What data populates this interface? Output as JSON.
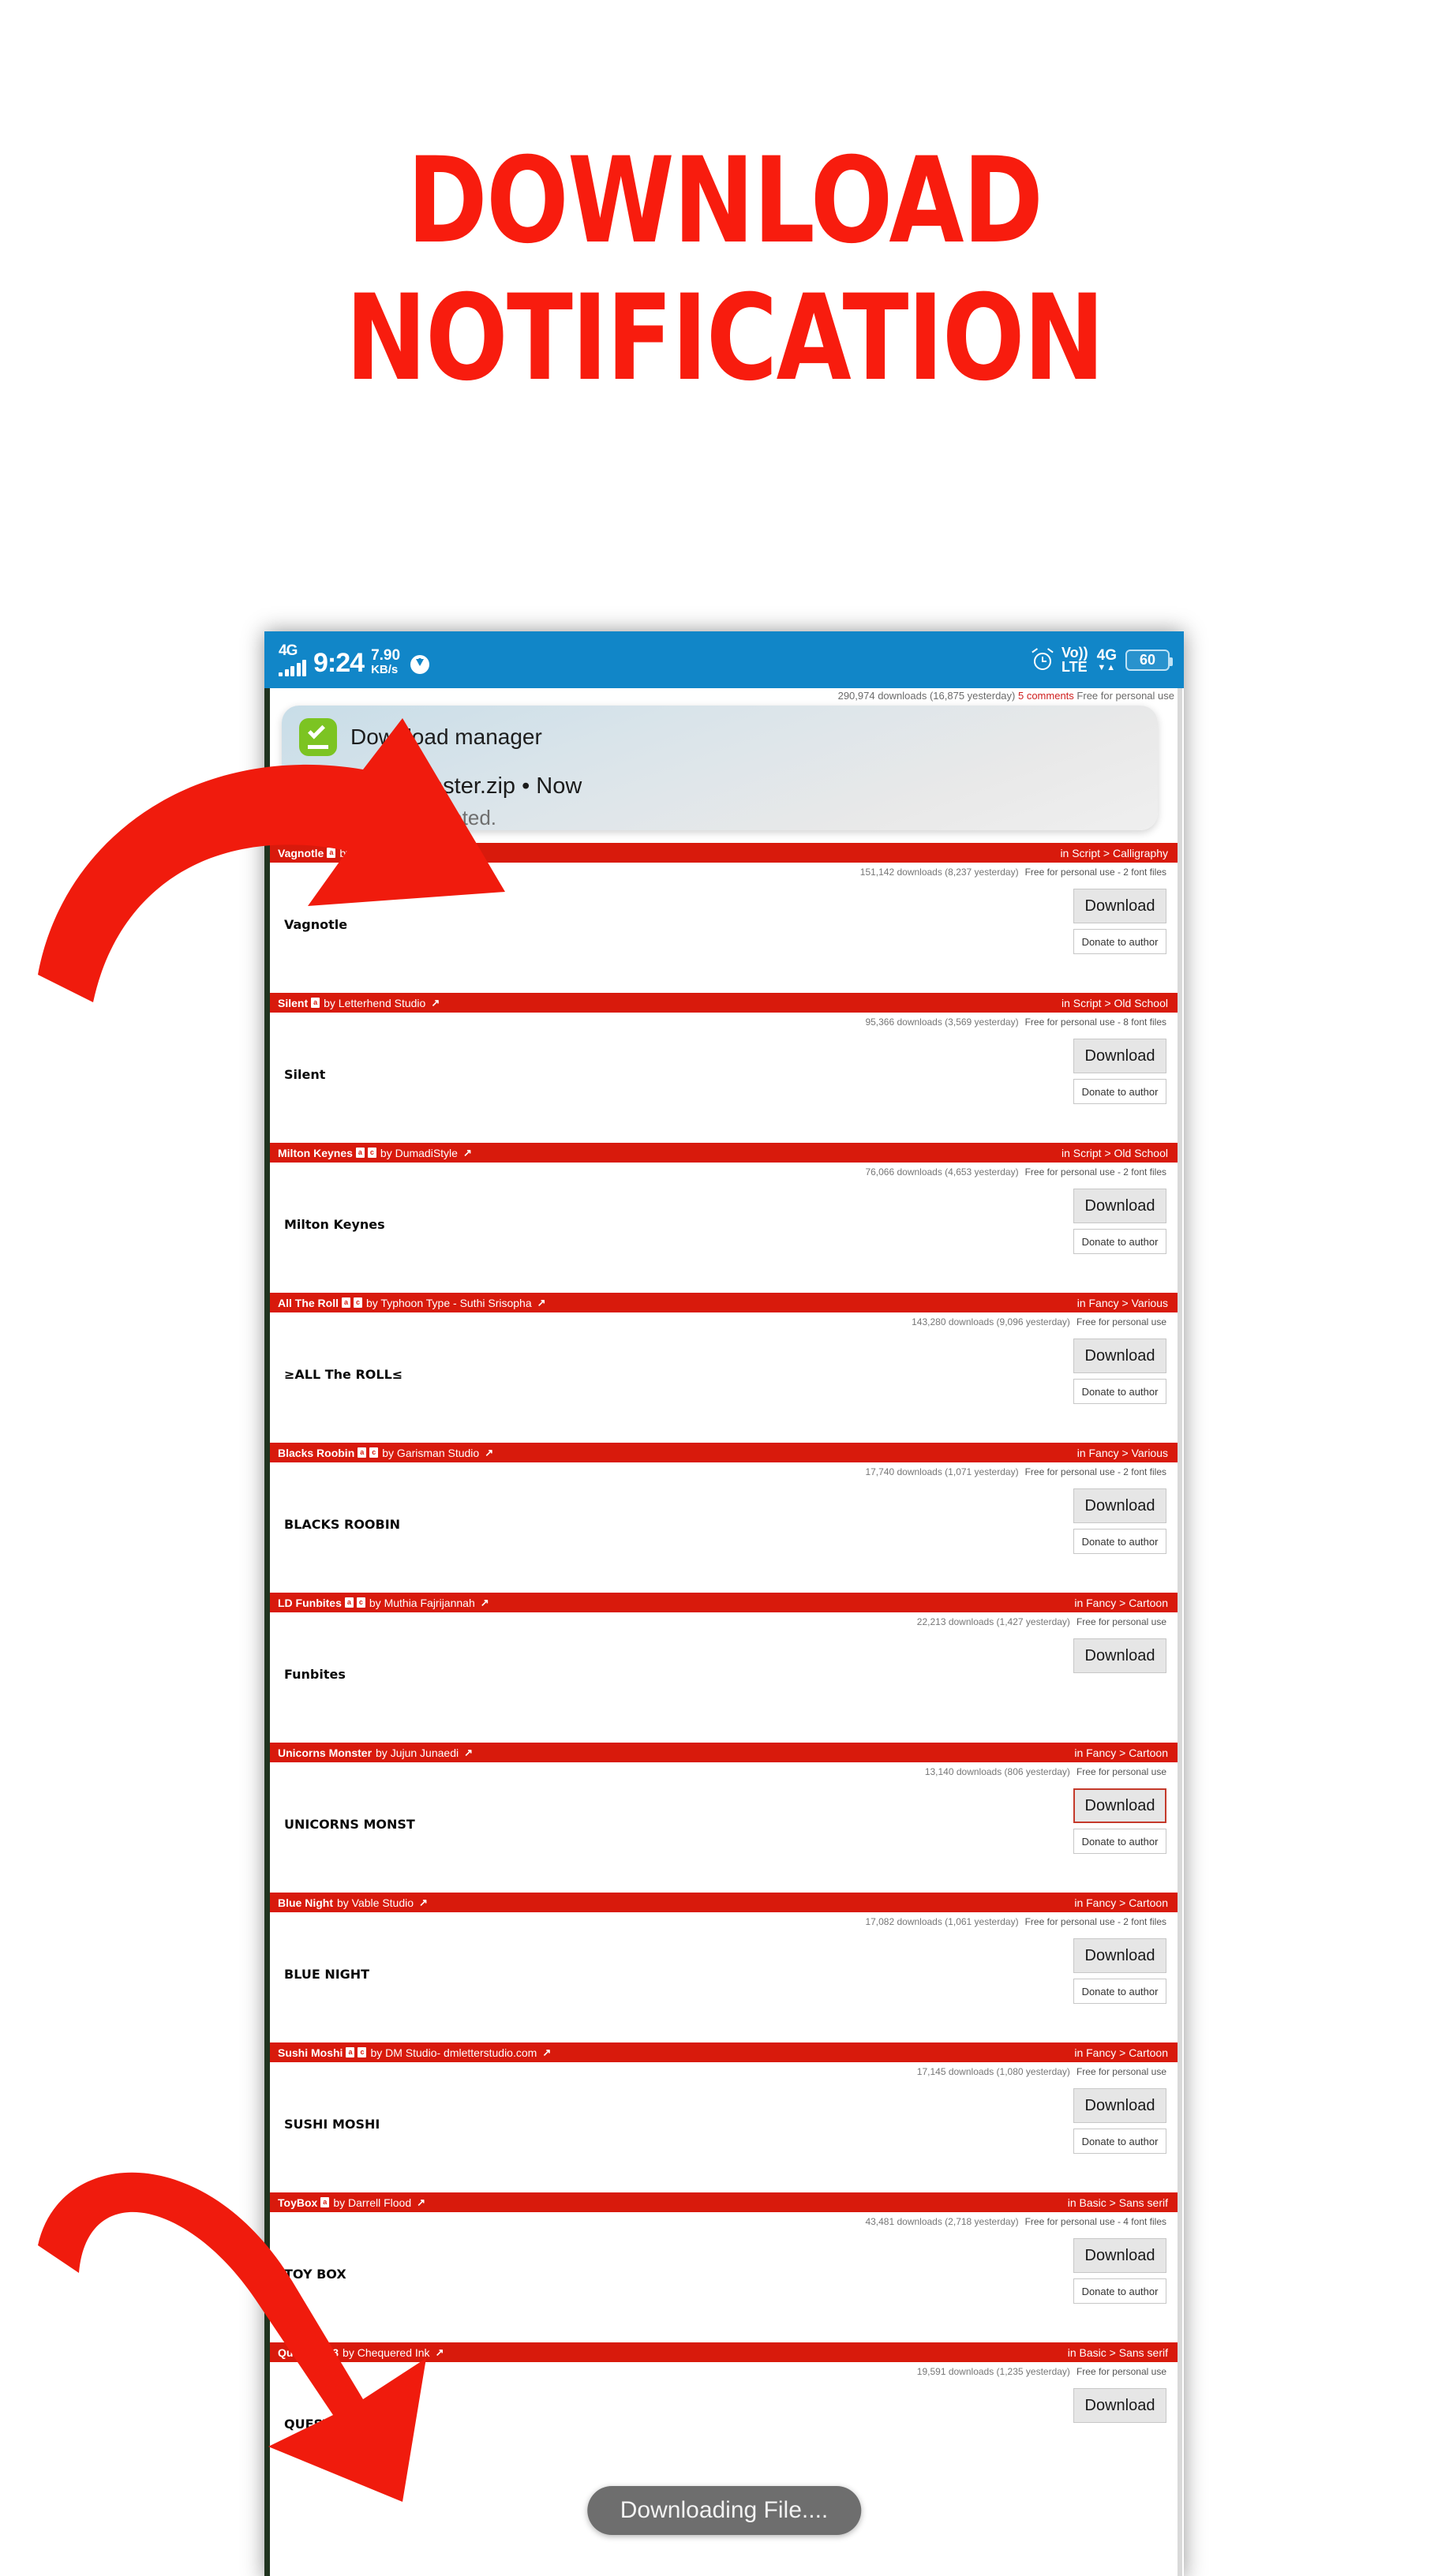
{
  "headline": {
    "line1": "DOWNLOAD",
    "line2": "NOTIFICATION",
    "color": "#f81c0e"
  },
  "phone": {
    "statusbar": {
      "network_type": "4G",
      "time": "9:24",
      "net_speed_value": "7.90",
      "net_speed_unit": "KB/s",
      "download_icon": "download-arrow-icon",
      "alarm_icon": "alarm-clock-icon",
      "volte_line1": "Vo))",
      "volte_line2": "LTE",
      "data_type": "4G",
      "data_arrows": "▼▲",
      "battery_level": "60",
      "bg_color": "#1186c8"
    },
    "notification": {
      "app_icon": "download-complete-check-icon",
      "app_name": "Download manager",
      "file_title": "unicorns_monster.zip  •  Now",
      "body": "Download completed."
    },
    "top_stats": {
      "downloads": "290,974 downloads (16,875 yesterday)",
      "comments": "5 comments",
      "license": "Free for personal use"
    },
    "toast": {
      "text": "Downloading File...."
    },
    "buttons": {
      "download_label": "Download",
      "donate_label": "Donate to author"
    },
    "font_rows": [
      {
        "name": "Vagnotle",
        "badges": [
          "a"
        ],
        "by": "by StringLabs Creative",
        "external_link_icon": "external-link-icon",
        "category": "in Script > Calligraphy",
        "downloads": "151,142 downloads (8,237 yesterday)",
        "license": "Free for personal use - 2 font files",
        "sample": "Vagnotle",
        "sample_style": "script",
        "highlighted": false,
        "has_donate": true
      },
      {
        "name": "Silent",
        "badges": [
          "a"
        ],
        "by": "by Letterhend Studio",
        "external_link_icon": "external-link-icon",
        "category": "in Script > Old School",
        "downloads": "95,366 downloads (3,569 yesterday)",
        "license": "Free for personal use - 8 font files",
        "sample": "Silent",
        "sample_style": "script",
        "highlighted": false,
        "has_donate": true
      },
      {
        "name": "Milton Keynes",
        "badges": [
          "a",
          "c"
        ],
        "by": "by DumadiStyle",
        "external_link_icon": "external-link-icon",
        "category": "in Script > Old School",
        "downloads": "76,066 downloads (4,653 yesterday)",
        "license": "Free for personal use - 2 font files",
        "sample": "Milton Keynes",
        "sample_style": "script",
        "highlighted": false,
        "has_donate": true
      },
      {
        "name": "All The Roll",
        "badges": [
          "a",
          "c"
        ],
        "by": "by Typhoon Type - Suthi Srisopha",
        "external_link_icon": "external-link-icon",
        "category": "in Fancy > Various",
        "downloads": "143,280 downloads (9,096 yesterday)",
        "license": "Free for personal use",
        "sample": "≥ALL The ROLL≤",
        "sample_style": "display",
        "highlighted": false,
        "has_donate": true
      },
      {
        "name": "Blacks Roobin",
        "badges": [
          "a",
          "c"
        ],
        "by": "by Garisman Studio",
        "external_link_icon": "external-link-icon",
        "category": "in Fancy > Various",
        "downloads": "17,740 downloads (1,071 yesterday)",
        "license": "Free for personal use - 2 font files",
        "sample": "BLACKS ROOBIN",
        "sample_style": "display",
        "highlighted": false,
        "has_donate": true
      },
      {
        "name": "LD Funbites",
        "badges": [
          "a",
          "c"
        ],
        "by": "by Muthia Fajrijannah",
        "external_link_icon": "external-link-icon",
        "category": "in Fancy > Cartoon",
        "downloads": "22,213 downloads (1,427 yesterday)",
        "license": "Free for personal use",
        "sample": "Funbites",
        "sample_style": "display",
        "highlighted": false,
        "has_donate": false
      },
      {
        "name": "Unicorns Monster",
        "badges": [],
        "by": "by Jujun Junaedi",
        "external_link_icon": "external-link-icon",
        "category": "in Fancy > Cartoon",
        "downloads": "13,140 downloads (806 yesterday)",
        "license": "Free for personal use",
        "sample": "UNICORNS MONST",
        "sample_style": "display",
        "highlighted": true,
        "has_donate": true
      },
      {
        "name": "Blue Night",
        "badges": [],
        "by": "by Vable Studio",
        "external_link_icon": "external-link-icon",
        "category": "in Fancy > Cartoon",
        "downloads": "17,082 downloads (1,061 yesterday)",
        "license": "Free for personal use - 2 font files",
        "sample": "BLUE NIGHT",
        "sample_style": "display",
        "highlighted": false,
        "has_donate": true
      },
      {
        "name": "Sushi Moshi",
        "badges": [
          "a",
          "c"
        ],
        "by": "by DM Studio- dmletterstudio.com",
        "external_link_icon": "external-link-icon",
        "category": "in Fancy > Cartoon",
        "downloads": "17,145 downloads (1,080 yesterday)",
        "license": "Free for personal use",
        "sample": "SUSHI MOSHI",
        "sample_style": "display",
        "highlighted": false,
        "has_donate": true
      },
      {
        "name": "ToyBox",
        "badges": [
          "a"
        ],
        "by": "by Darrell Flood",
        "external_link_icon": "external-link-icon",
        "category": "in Basic > Sans serif",
        "downloads": "43,481 downloads (2,718 yesterday)",
        "license": "Free for personal use - 4 font files",
        "sample": "TOY BOX",
        "sample_style": "display",
        "highlighted": false,
        "has_donate": true
      },
      {
        "name": "Questrian 3",
        "badges": [],
        "by": "by Chequered Ink",
        "external_link_icon": "external-link-icon",
        "category": "in Basic > Sans serif",
        "downloads": "19,591 downloads (1,235 yesterday)",
        "license": "Free for personal use",
        "sample": "QUESTRIAN 3",
        "sample_style": "display",
        "highlighted": false,
        "has_donate": false
      }
    ]
  },
  "arrows": {
    "top_arrow_icon": "curved-arrow-pointing-up-right-icon",
    "bottom_arrow_icon": "curved-arrow-pointing-down-right-icon",
    "color": "#f01b0d"
  }
}
